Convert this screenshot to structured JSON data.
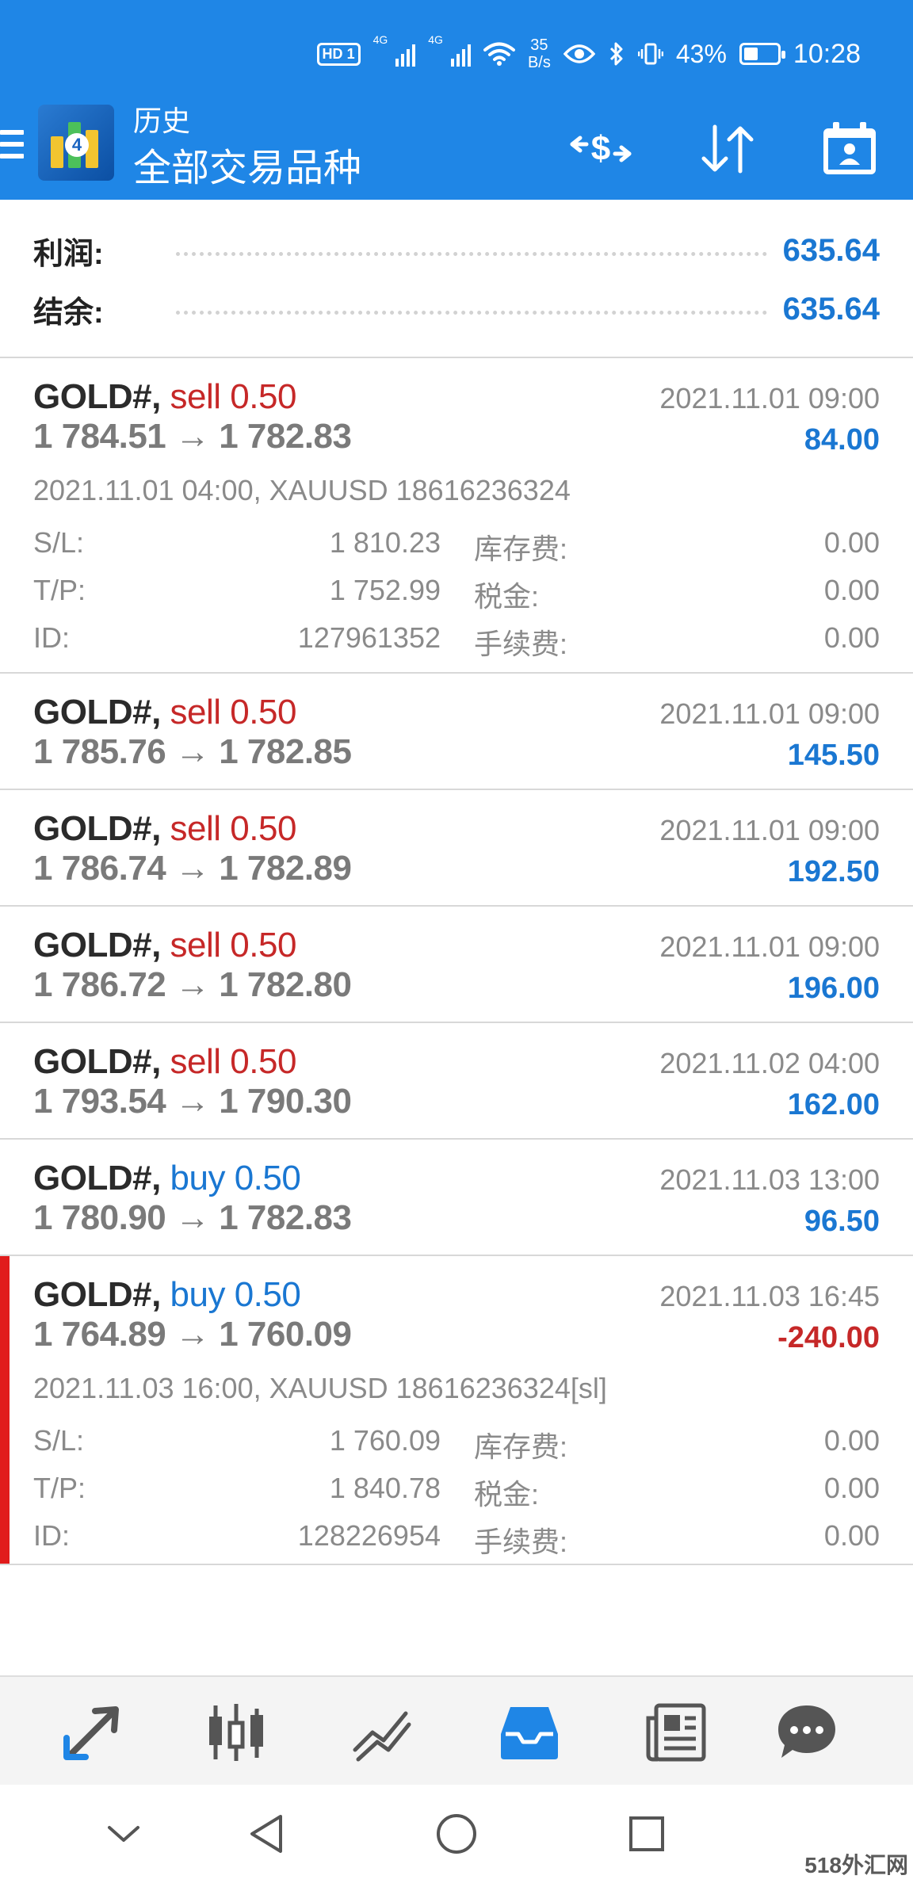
{
  "status_bar": {
    "hd": "HD",
    "hd_sim": "1",
    "net1": "4G",
    "net2": "4G",
    "speed_value": "35",
    "speed_unit": "B/s",
    "battery": "43%",
    "battery_level": 0.43,
    "time": "10:28"
  },
  "header": {
    "title_small": "历史",
    "title_main": "全部交易品种",
    "logo_badge": "4"
  },
  "summary": {
    "profit_label": "利润:",
    "profit_value": "635.64",
    "balance_label": "结余:",
    "balance_value": "635.64"
  },
  "trades": [
    {
      "symbol": "GOLD#,",
      "side": "sell 0.50",
      "prices": "1 784.51 → 1 782.83",
      "close_time": "2021.11.01 09:00",
      "profit": "84.00",
      "expanded": true,
      "open_info": "2021.11.01 04:00, XAUUSD 18616236324",
      "sl_label": "S/L:",
      "sl": "1 810.23",
      "tp_label": "T/P:",
      "tp": "1 752.99",
      "id_label": "ID:",
      "id": "127961352",
      "swap_label": "库存费:",
      "swap": "0.00",
      "tax_label": "税金:",
      "tax": "0.00",
      "fee_label": "手续费:",
      "fee": "0.00"
    },
    {
      "symbol": "GOLD#,",
      "side": "sell 0.50",
      "prices": "1 785.76 → 1 782.85",
      "close_time": "2021.11.01 09:00",
      "profit": "145.50"
    },
    {
      "symbol": "GOLD#,",
      "side": "sell 0.50",
      "prices": "1 786.74 → 1 782.89",
      "close_time": "2021.11.01 09:00",
      "profit": "192.50"
    },
    {
      "symbol": "GOLD#,",
      "side": "sell 0.50",
      "prices": "1 786.72 → 1 782.80",
      "close_time": "2021.11.01 09:00",
      "profit": "196.00"
    },
    {
      "symbol": "GOLD#,",
      "side": "sell 0.50",
      "prices": "1 793.54 → 1 790.30",
      "close_time": "2021.11.02 04:00",
      "profit": "162.00"
    },
    {
      "symbol": "GOLD#,",
      "side": "buy 0.50",
      "prices": "1 780.90 → 1 782.83",
      "close_time": "2021.11.03 13:00",
      "profit": "96.50"
    },
    {
      "symbol": "GOLD#,",
      "side": "buy 0.50",
      "prices": "1 764.89 → 1 760.09",
      "close_time": "2021.11.03 16:45",
      "profit": "-240.00",
      "expanded": true,
      "open_info": "2021.11.03 16:00, XAUUSD 18616236324[sl]",
      "sl_label": "S/L:",
      "sl": "1 760.09",
      "tp_label": "T/P:",
      "tp": "1 840.78",
      "id_label": "ID:",
      "id": "128226954",
      "swap_label": "库存费:",
      "swap": "0.00",
      "tax_label": "税金:",
      "tax": "0.00",
      "fee_label": "手续费:",
      "fee": "0.00"
    }
  ],
  "icons": {
    "header": [
      "currency-exchange-icon",
      "sort-icon",
      "calendar-user-icon"
    ],
    "bottom_nav": [
      "quotes-arrows-icon",
      "candlestick-chart-icon",
      "trend-lines-icon",
      "inbox-history-icon",
      "news-icon",
      "chat-bubble-icon"
    ],
    "system_nav": [
      "chevron-down-icon",
      "back-triangle-icon",
      "home-circle-icon",
      "recents-square-icon"
    ]
  },
  "colors": {
    "header_bg": "#1f86e6",
    "profit_blue": "#1a77d2",
    "sell_red": "#c62828",
    "selection_bar": "#e11c1c"
  },
  "watermark": "518外汇网"
}
